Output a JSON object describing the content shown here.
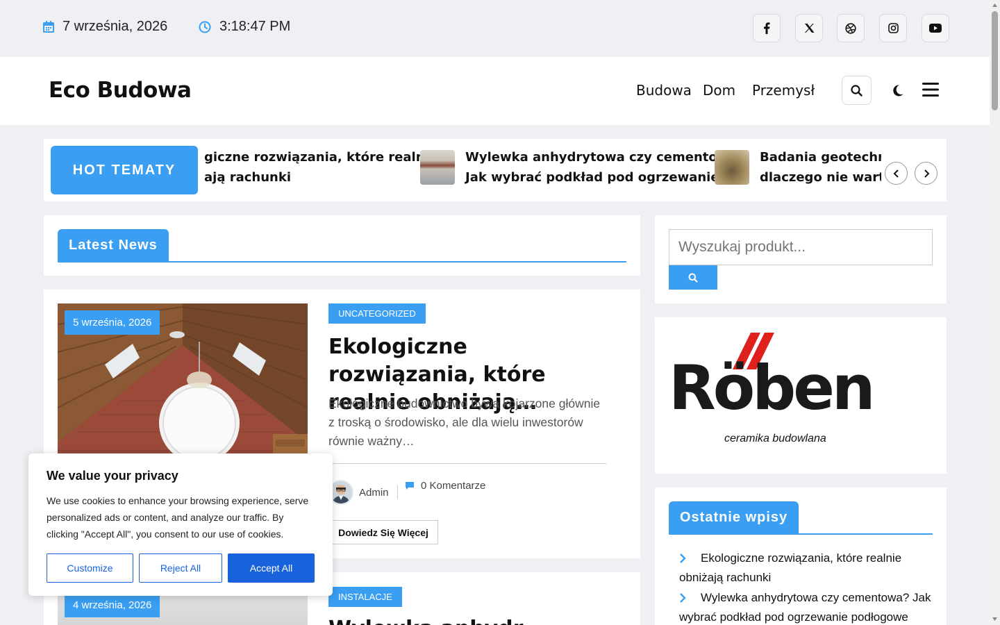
{
  "topbar": {
    "date": "7 września, 2026",
    "time": "3:18:47 PM",
    "socials": [
      "facebook-icon",
      "x-twitter-icon",
      "dribbble-icon",
      "instagram-icon",
      "youtube-icon"
    ]
  },
  "header": {
    "logo": "Eco Budowa",
    "nav": [
      "Budowa",
      "Dom",
      "Przemysł"
    ]
  },
  "ticker": {
    "label": "HOT TEMATY",
    "items": [
      {
        "line1": "giczne rozwiązania, które realnie",
        "line2": "ają rachunki"
      },
      {
        "line1": "Wylewka anhydrytowa czy cementowa?",
        "line2": "Jak wybrać podkład pod ogrzewanie…"
      },
      {
        "line1": "Badania geotechnicz",
        "line2": "dlaczego nie warto i"
      }
    ]
  },
  "latest": {
    "title": "Latest News",
    "posts": [
      {
        "date": "5 września, 2026",
        "category": "UNCATEGORIZED",
        "title": "Ekologiczne rozwiązania, które realnie obniżają…",
        "excerpt": "Ekologiczne budownictwo bywa kojarzone głównie z troską o środowisko, ale dla wielu inwestorów równie ważny…",
        "author": "Admin",
        "comments": "0 Komentarze",
        "more": "Dowiedz Się Więcej"
      },
      {
        "date": "4 września, 2026",
        "category": "INSTALACJE",
        "title": "Wylewka anhydr"
      }
    ]
  },
  "sidebar": {
    "search_placeholder": "Wyszukaj produkt...",
    "ad": {
      "brand": "Röben",
      "tagline": "ceramika budowlana"
    },
    "recent_title": "Ostatnie wpisy",
    "recent": [
      "Ekologiczne rozwiązania, które realnie obniżają rachunki",
      "Wylewka anhydrytowa czy cementowa? Jak wybrać podkład pod ogrzewanie podłogowe"
    ]
  },
  "cookie": {
    "title": "We value your privacy",
    "text": "We use cookies to enhance your browsing experience, serve personalized ads or content, and analyze our traffic. By clicking \"Accept All\", you consent to our use of cookies.",
    "customize": "Customize",
    "reject": "Reject All",
    "accept": "Accept All"
  },
  "colors": {
    "accent": "#3a9ff2",
    "cookie_primary": "#1863dc"
  }
}
